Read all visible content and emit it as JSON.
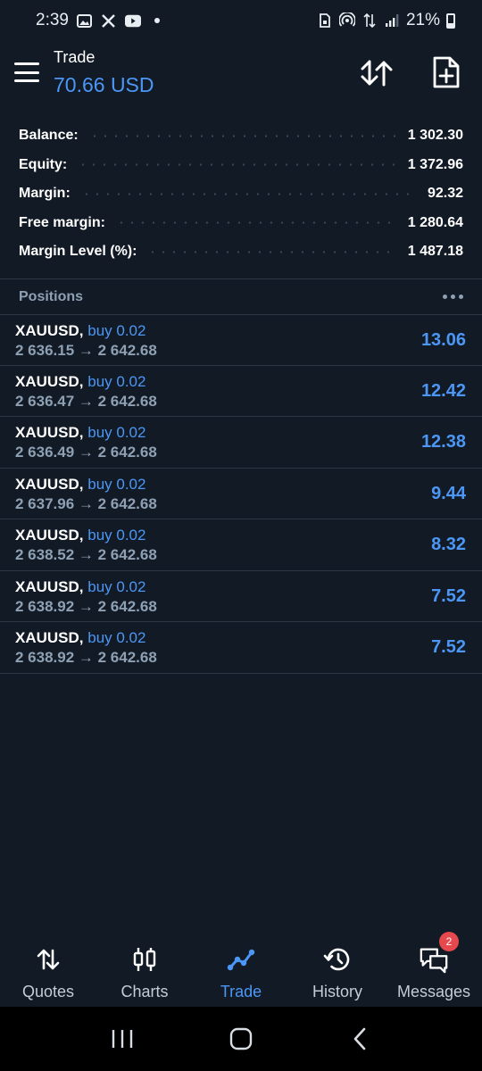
{
  "status_bar": {
    "time": "2:39",
    "battery": "21%"
  },
  "header": {
    "title": "Trade",
    "amount": "70.66 USD"
  },
  "account": [
    {
      "label": "Balance:",
      "value": "1 302.30"
    },
    {
      "label": "Equity:",
      "value": "1 372.96"
    },
    {
      "label": "Margin:",
      "value": "92.32"
    },
    {
      "label": "Free margin:",
      "value": "1 280.64"
    },
    {
      "label": "Margin Level (%):",
      "value": "1 487.18"
    }
  ],
  "positions": {
    "title": "Positions",
    "items": [
      {
        "symbol": "XAUUSD,",
        "side": "buy 0.02",
        "prices": "2 636.15 → 2 642.68",
        "profit": "13.06"
      },
      {
        "symbol": "XAUUSD,",
        "side": "buy 0.02",
        "prices": "2 636.47 → 2 642.68",
        "profit": "12.42"
      },
      {
        "symbol": "XAUUSD,",
        "side": "buy 0.02",
        "prices": "2 636.49 → 2 642.68",
        "profit": "12.38"
      },
      {
        "symbol": "XAUUSD,",
        "side": "buy 0.02",
        "prices": "2 637.96 → 2 642.68",
        "profit": "9.44"
      },
      {
        "symbol": "XAUUSD,",
        "side": "buy 0.02",
        "prices": "2 638.52 → 2 642.68",
        "profit": "8.32"
      },
      {
        "symbol": "XAUUSD,",
        "side": "buy 0.02",
        "prices": "2 638.92 → 2 642.68",
        "profit": "7.52"
      },
      {
        "symbol": "XAUUSD,",
        "side": "buy 0.02",
        "prices": "2 638.92 → 2 642.68",
        "profit": "7.52"
      }
    ]
  },
  "nav": {
    "items": [
      {
        "label": "Quotes",
        "icon": "quotes-arrows-icon"
      },
      {
        "label": "Charts",
        "icon": "candlestick-icon"
      },
      {
        "label": "Trade",
        "icon": "trade-line-icon"
      },
      {
        "label": "History",
        "icon": "history-clock-icon"
      },
      {
        "label": "Messages",
        "icon": "messages-icon"
      }
    ],
    "active": "Trade",
    "messages_badge": "2"
  },
  "colors": {
    "background": "#121a25",
    "accent": "#4c97f5",
    "muted": "#8ea0b3",
    "badge": "#e5484d"
  }
}
